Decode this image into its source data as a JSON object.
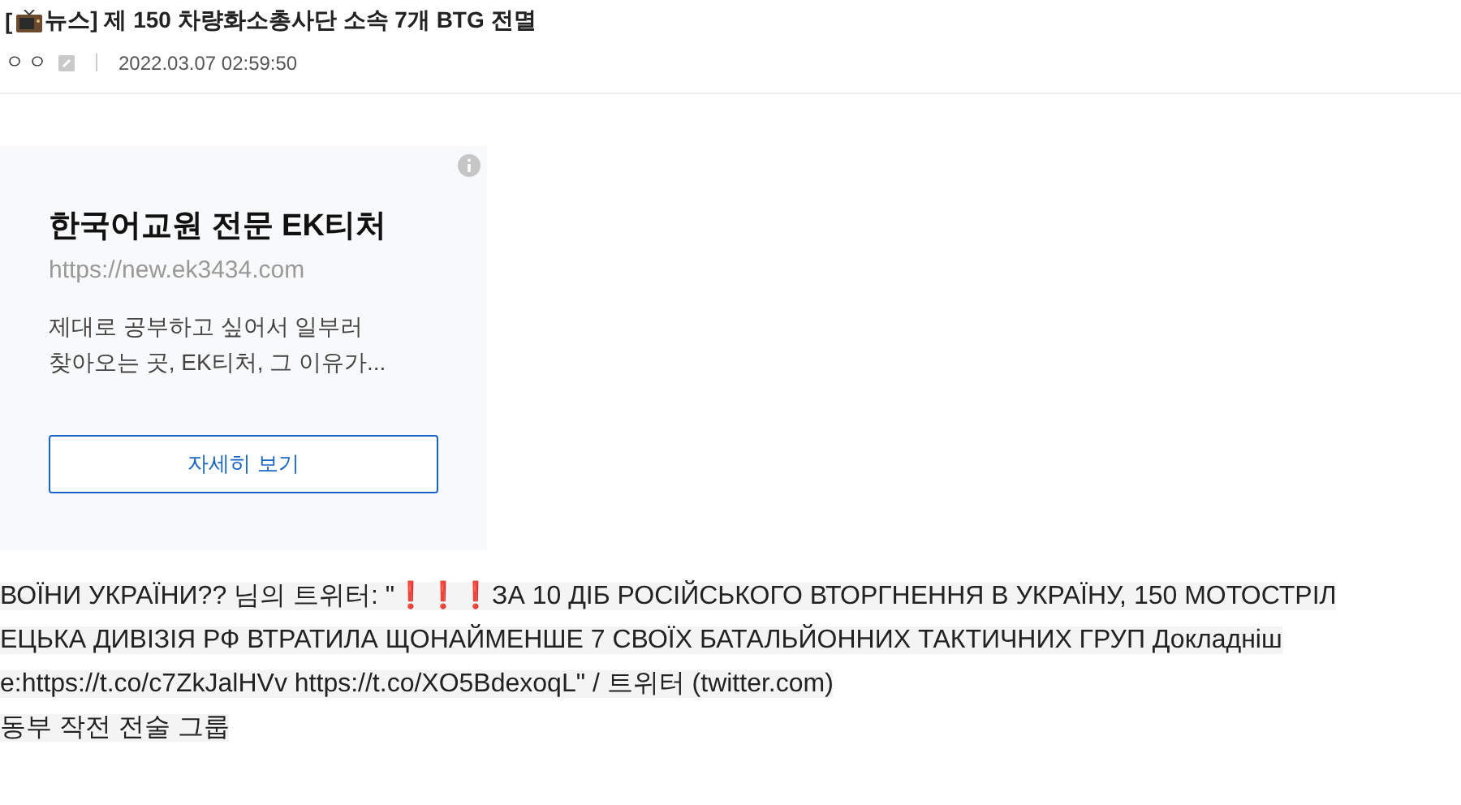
{
  "post": {
    "title_prefix": "[",
    "title_rest": "뉴스] 제 150 차량화소총사단 소속 7개 BTG 전멸",
    "author": "ㅇㅇ",
    "date": "2022.03.07 02:59:50"
  },
  "ad": {
    "title": "한국어교원 전문 EK티처",
    "url": "https://new.ek3434.com",
    "description_lines": [
      "제대로 공부하고 싶어서 일부러",
      "찾아오는 곳, EK티처, 그 이유가..."
    ],
    "button": "자세히 보기"
  },
  "body": {
    "lines": [
      {
        "before": "ВОЇНИ УКРАЇНИ?? 님의 트위터: \"",
        "marks": "❗❗❗",
        "after": "ЗА 10 ДІБ РОСІЙСЬКОГО ВТОРГНЕННЯ В УКРАЇНУ, 150 МОТОСТРІЛ"
      },
      {
        "before": "ЕЦЬКА ДИВІЗІЯ РФ ВТРАТИЛА ЩОНАЙМЕНШЕ 7 СВОЇХ БАТАЛЬЙОННИХ ТАКТИЧНИХ ГРУП Докладніш"
      },
      {
        "before": "e:https://t.co/c7ZkJalHVv https://t.co/XO5BdexoqL\" / 트위터 (twitter.com)"
      },
      {
        "before": "동부 작전 전술 그룹"
      }
    ]
  }
}
